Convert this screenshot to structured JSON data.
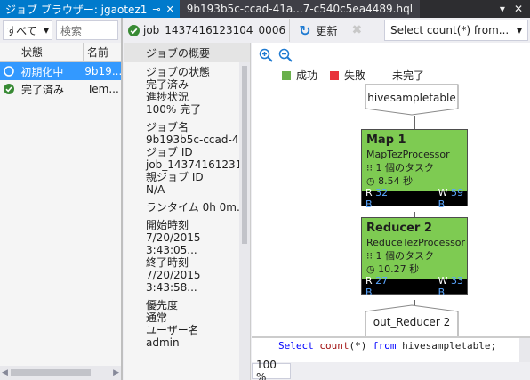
{
  "titlebar": {
    "active_tab": "ジョブ ブラウザー: jgaotez1",
    "pin_icon": "pin-icon",
    "close_icon": "close-icon",
    "inactive_tab": "9b193b5c-ccad-41a...7-c540c5ea4489.hql",
    "right_dropdown": "▾",
    "right_close": "✕"
  },
  "left": {
    "filter_value": "すべて",
    "search_placeholder": "検索",
    "col_state": "状態",
    "col_name": "名前",
    "jobs": [
      {
        "state": "初期化中",
        "name": "9b19...",
        "icon": "circle-outline-icon",
        "selected": true
      },
      {
        "state": "完了済み",
        "name": "Tem...",
        "icon": "check-circle-icon",
        "selected": false
      }
    ]
  },
  "toolbar": {
    "job_id": "job_1437416123104_0006",
    "refresh_label": "更新",
    "query_select": "Select count(*) from..."
  },
  "summary": {
    "header": "ジョブの概要",
    "status_label": "ジョブの状態",
    "status_value": "完了済み",
    "progress_label": "進捗状況",
    "progress_value": "100% 完了",
    "job_name_label": "ジョブ名",
    "job_name_value": "9b193b5c-ccad-4...",
    "job_id_label": "ジョブ ID",
    "job_id_value": "job_14374161231...",
    "parent_label": "親ジョブ ID",
    "parent_value": "N/A",
    "runtime": "ランタイム   0h 0m...",
    "start_label": "開始時刻",
    "start_value": "7/20/2015 3:43:05...",
    "end_label": "終了時刻",
    "end_value": "7/20/2015 3:43:58...",
    "priority_label": "優先度",
    "priority_value": "通常",
    "user_label": "ユーザー名",
    "user_value": "admin"
  },
  "diagram": {
    "legend": [
      {
        "label": "成功",
        "color": "#6ab04c"
      },
      {
        "label": "失敗",
        "color": "#e8323c"
      },
      {
        "label": "未完了",
        "color": "#ffffff"
      }
    ],
    "input": "hivesampletable",
    "nodes": [
      {
        "title": "Map 1",
        "processor": "MapTezProcessor",
        "tasks": "1 個のタスク",
        "time": "8.54 秒",
        "r_value": "32 B",
        "w_value": "59 B"
      },
      {
        "title": "Reducer 2",
        "processor": "ReduceTezProcessor",
        "tasks": "1 個のタスク",
        "time": "10.27 秒",
        "r_value": "27 B",
        "w_value": "33 B"
      }
    ],
    "output": "out_Reducer 2"
  },
  "query": {
    "kw1": "Select",
    "fn": "count",
    "mid": "(*)",
    "kw2": "from",
    "table": "hivesampletable;"
  },
  "bottom": {
    "zoom": "100 %"
  }
}
